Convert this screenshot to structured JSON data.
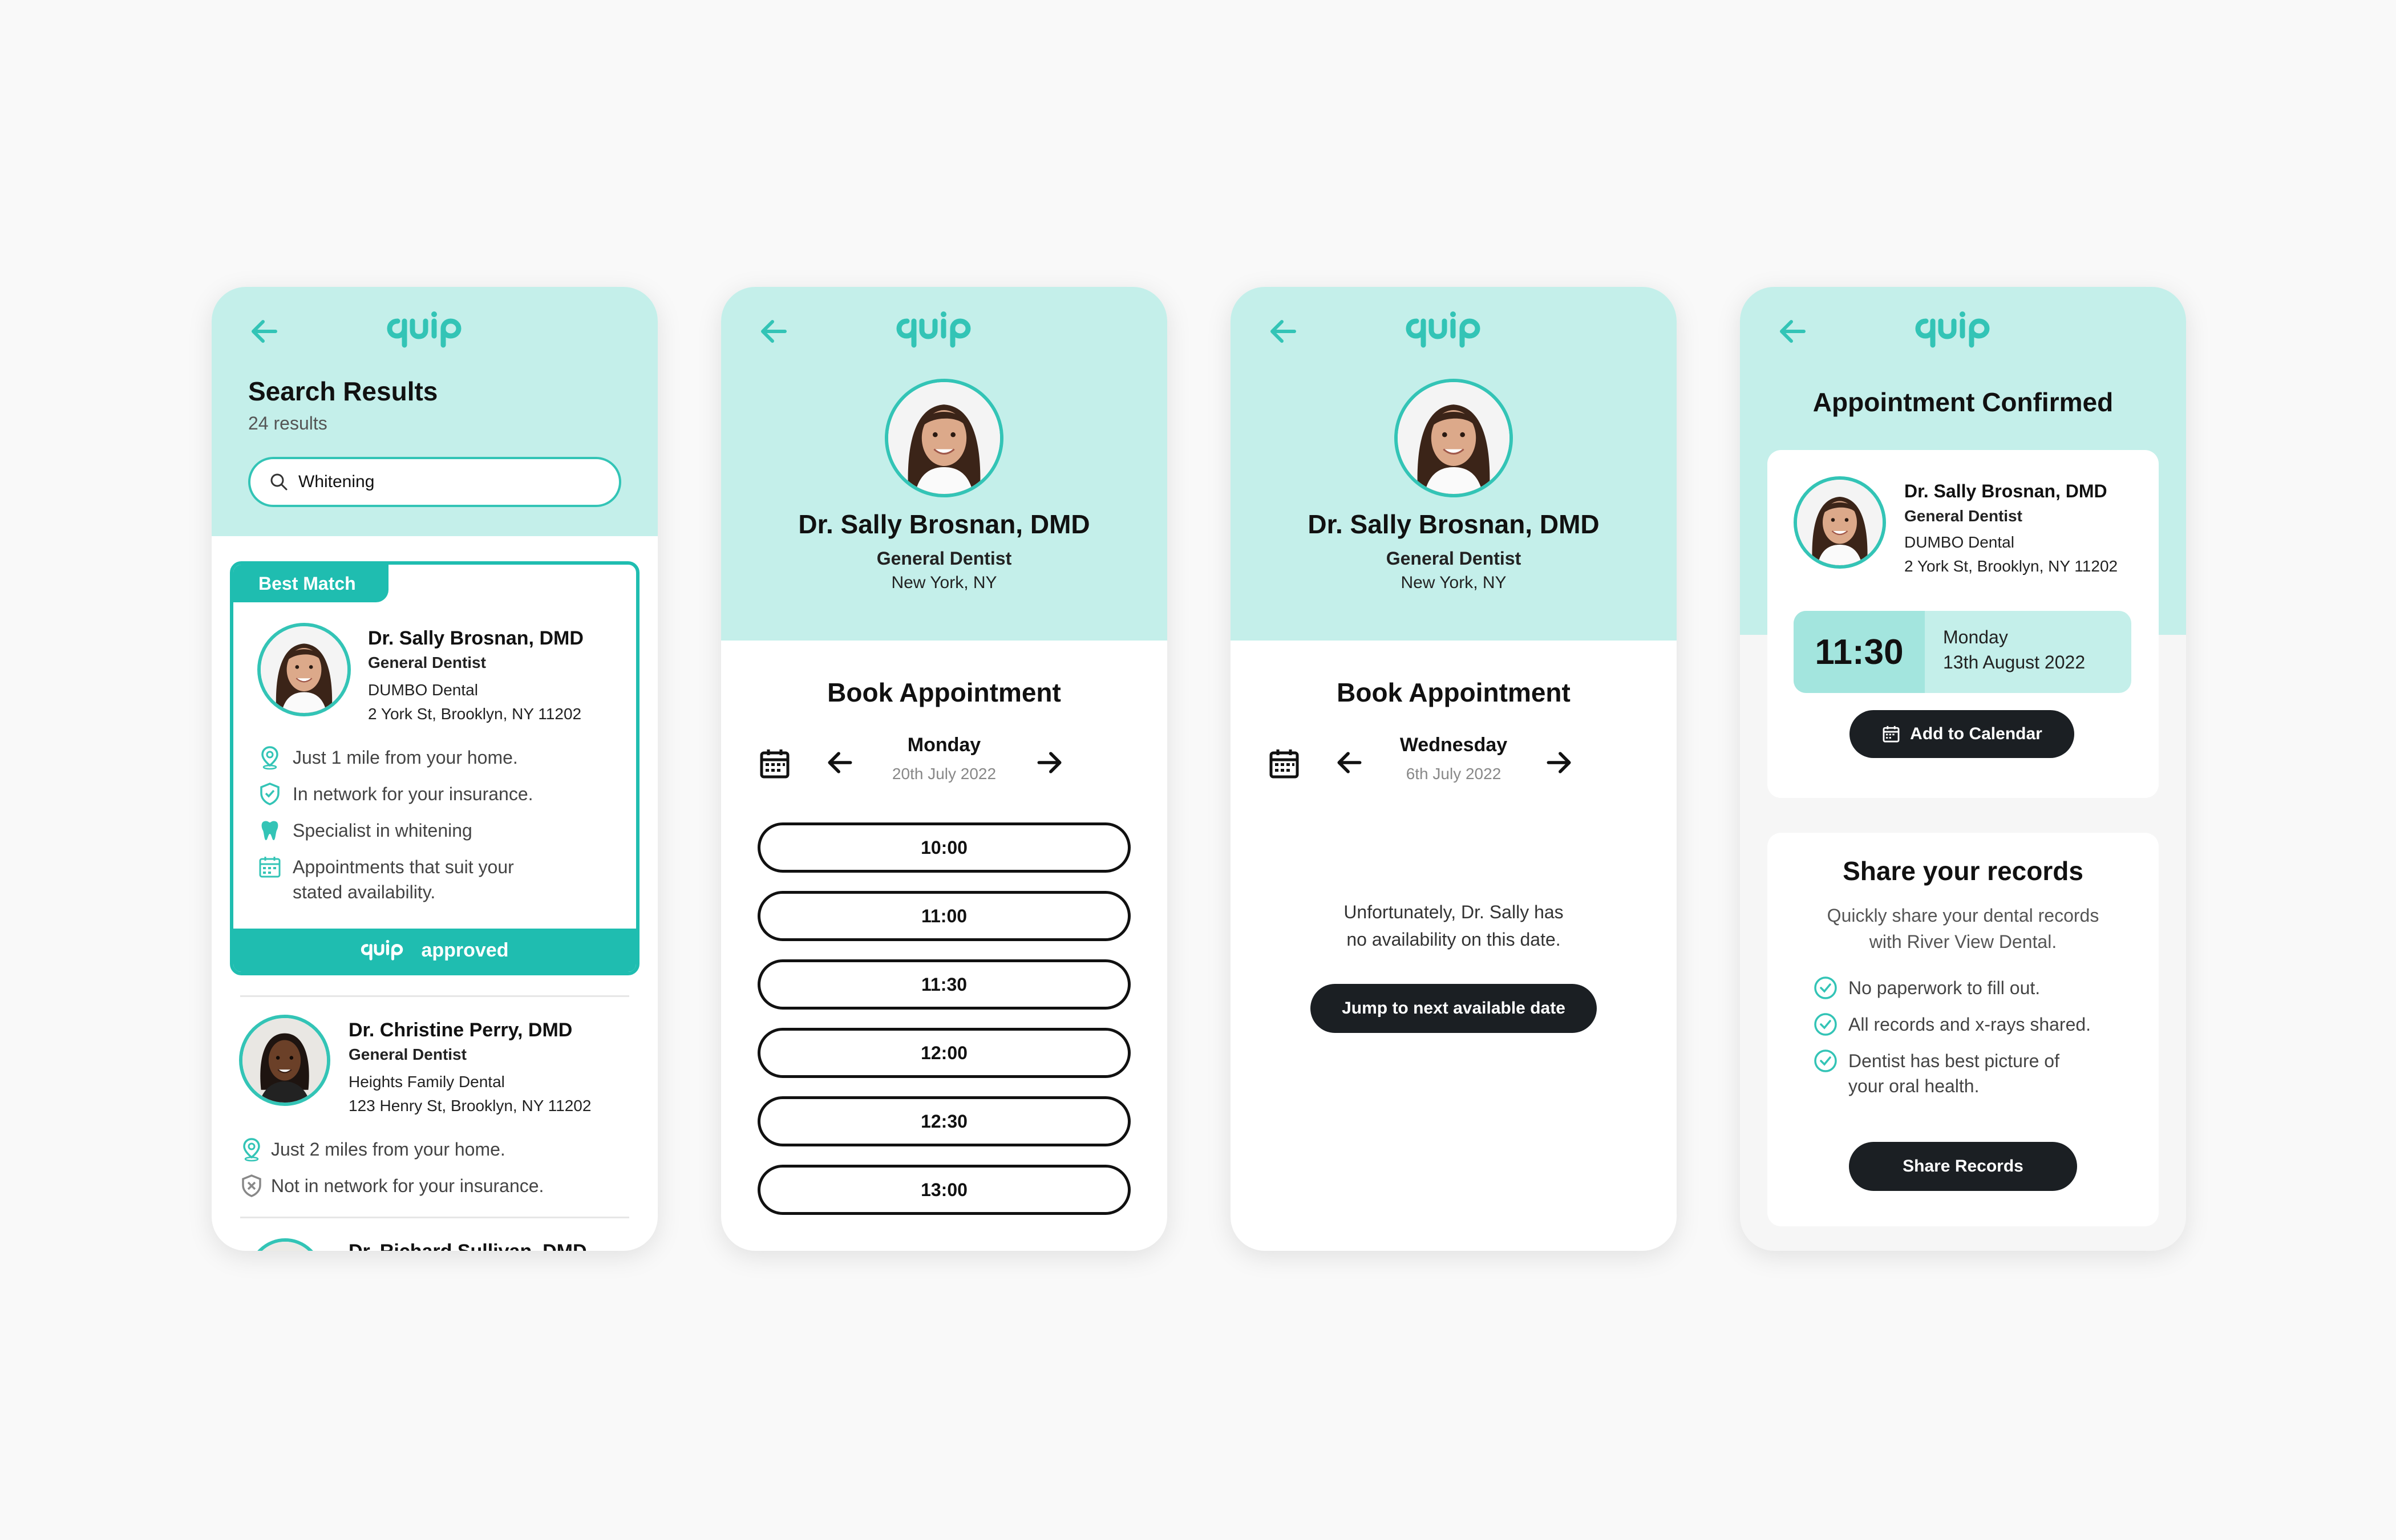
{
  "brand": {
    "logo_text": "quip",
    "teal": "#33c4b6",
    "mint": "#c4efea",
    "dark": "#1b1f23"
  },
  "search_screen": {
    "title": "Search Results",
    "count": "24 results",
    "search_value": "Whitening",
    "best_match_badge": "Best Match",
    "approved_label": "approved",
    "results": [
      {
        "name": "Dr. Sally Brosnan, DMD",
        "specialty": "General Dentist",
        "practice": "DUMBO Dental",
        "address": "2 York St, Brooklyn, NY 11202",
        "features": [
          "Just 1 mile from your home.",
          "In network for your insurance.",
          "Specialist in whitening",
          "Appointments that suit your",
          "stated availability."
        ]
      },
      {
        "name": "Dr. Christine Perry, DMD",
        "specialty": "General Dentist",
        "practice": "Heights Family Dental",
        "address": "123 Henry St, Brooklyn, NY 11202",
        "features": [
          "Just 2 miles from your home.",
          "Not in network for your insurance."
        ]
      },
      {
        "name": "Dr. Richard Sullivan, DMD"
      }
    ]
  },
  "profile": {
    "name": "Dr. Sally Brosnan, DMD",
    "specialty": "General Dentist",
    "location": "New York, NY"
  },
  "booking_screen": {
    "title": "Book Appointment",
    "day": "Monday",
    "date": "20th July 2022",
    "slots": [
      "10:00",
      "11:00",
      "11:30",
      "12:00",
      "12:30",
      "13:00"
    ]
  },
  "no_availability_screen": {
    "title": "Book Appointment",
    "day": "Wednesday",
    "date": "6th July 2022",
    "message_line1": "Unfortunately, Dr. Sally has",
    "message_line2": "no availability on this date.",
    "jump_button": "Jump to next available date"
  },
  "confirmed_screen": {
    "title": "Appointment Confirmed",
    "name": "Dr. Sally Brosnan, DMD",
    "specialty": "General Dentist",
    "practice": "DUMBO Dental",
    "address": "2 York St, Brooklyn, NY 11202",
    "time": "11:30",
    "day": "Monday",
    "date": "13th August 2022",
    "calendar_button": "Add to Calendar",
    "share_title": "Share your records",
    "share_desc_line1": "Quickly share your dental records",
    "share_desc_line2": "with River View Dental.",
    "share_points": [
      "No paperwork to fill out.",
      "All records and x-rays shared.",
      "Dentist has best picture of",
      "your oral health."
    ],
    "share_button": "Share Records"
  }
}
